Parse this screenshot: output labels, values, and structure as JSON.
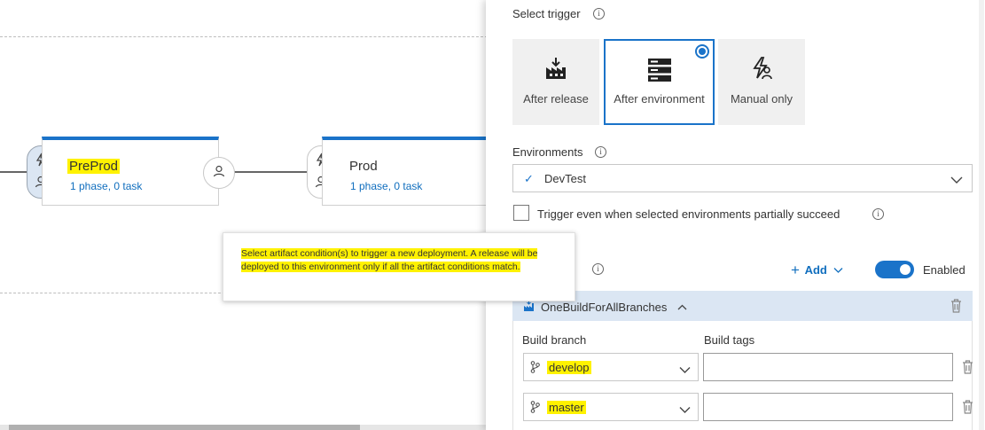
{
  "pipeline": {
    "stages": [
      {
        "name": "PreProd",
        "subtitle": "1 phase, 0 task"
      },
      {
        "name": "Prod",
        "subtitle": "1 phase, 0 task"
      }
    ],
    "tooltip": "Select artifact condition(s) to trigger a new deployment. A release will be deployed to this environment only if all the artifact conditions match."
  },
  "panel": {
    "select_trigger_label": "Select trigger",
    "triggers": [
      {
        "label": "After release",
        "icon": "after-release-icon",
        "selected": false
      },
      {
        "label": "After environment",
        "icon": "server-icon",
        "selected": true
      },
      {
        "label": "Manual only",
        "icon": "manual-trigger-icon",
        "selected": false
      }
    ],
    "environments_label": "Environments",
    "environments_value": "DevTest",
    "partial_succeed_label": "Trigger even when selected environments partially succeed",
    "add_label": "Add",
    "enabled_label": "Enabled",
    "artifact_name": "OneBuildForAllBranches",
    "build_branch_label": "Build branch",
    "build_tags_label": "Build tags",
    "branches": [
      {
        "value": "develop",
        "tags": ""
      },
      {
        "value": "master",
        "tags": ""
      }
    ]
  },
  "colors": {
    "accent": "#1a73c9",
    "highlight": "#fff200",
    "selected_bg": "#dbe6f3"
  }
}
